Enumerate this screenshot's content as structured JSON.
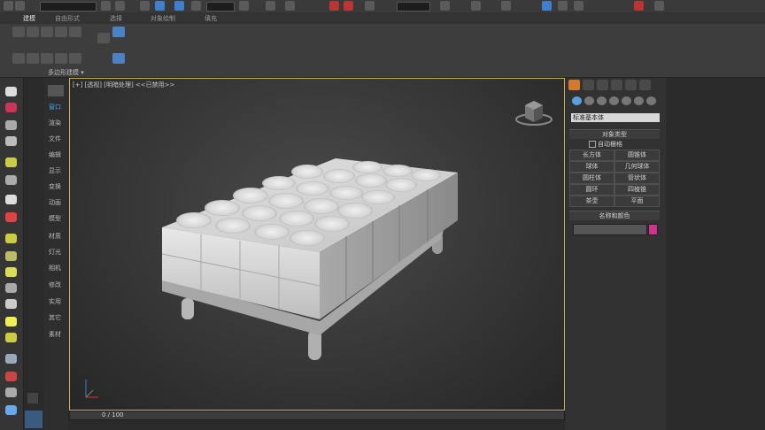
{
  "ribbon": {
    "tabs": [
      "建模",
      "自由形式",
      "选择",
      "对象绘制",
      "填充"
    ],
    "active_tab": "建模",
    "panel_label": "多边形建模 ▾"
  },
  "side_menu": {
    "items": [
      "窗口",
      "渲染",
      "文件",
      "编辑",
      "显示",
      "变换",
      "动画",
      "模型",
      "材质",
      "灯光",
      "相机",
      "修改",
      "实用",
      "其它",
      "素材"
    ],
    "active_index": 0
  },
  "viewport": {
    "label": "[+] [透视] [明暗处理] <<已禁用>>",
    "border_color": "#c9b25a"
  },
  "timeline": {
    "frame_text": "0 / 100"
  },
  "command_panel": {
    "dropdown_value": "标准基本体",
    "object_type_header": "对象类型",
    "autogrid_label": "自动栅格",
    "buttons": [
      "长方体",
      "圆锥体",
      "球体",
      "几何球体",
      "圆柱体",
      "管状体",
      "圆环",
      "四棱锥",
      "茶壶",
      "平面"
    ],
    "name_color_header": "名称和颜色",
    "swatch_color": "#d0338a",
    "accent_color": "#d07a2a"
  }
}
